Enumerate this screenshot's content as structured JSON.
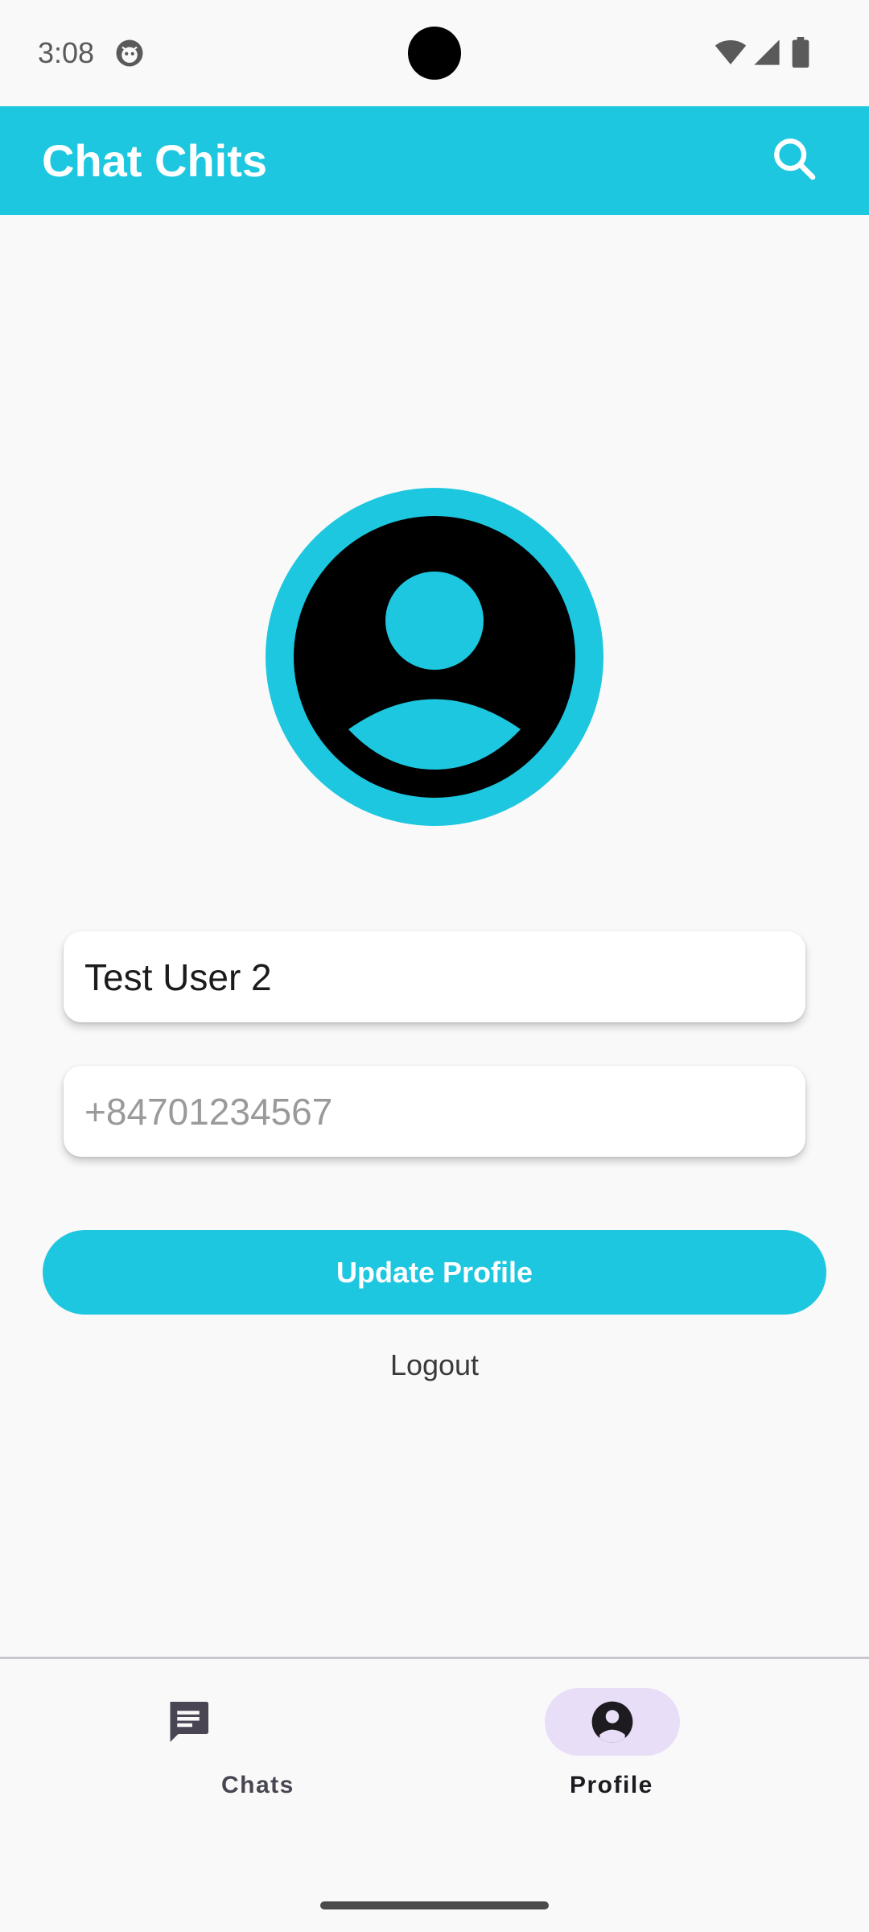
{
  "status_bar": {
    "time": "3:08"
  },
  "app_bar": {
    "title": "Chat Chits",
    "search_icon": "search-icon"
  },
  "profile": {
    "avatar_icon": "account-circle-icon",
    "name_value": "Test User 2",
    "phone_placeholder": "+84701234567",
    "update_label": "Update Profile",
    "logout_label": "Logout"
  },
  "bottom_nav": {
    "items": [
      {
        "label": "Chats",
        "icon": "chat-icon",
        "selected": false
      },
      {
        "label": "Profile",
        "icon": "account-circle-icon",
        "selected": true
      }
    ]
  },
  "colors": {
    "accent": "#1dc7df",
    "nav_selected_pill": "#e9def7",
    "background": "#f9f9f9"
  }
}
